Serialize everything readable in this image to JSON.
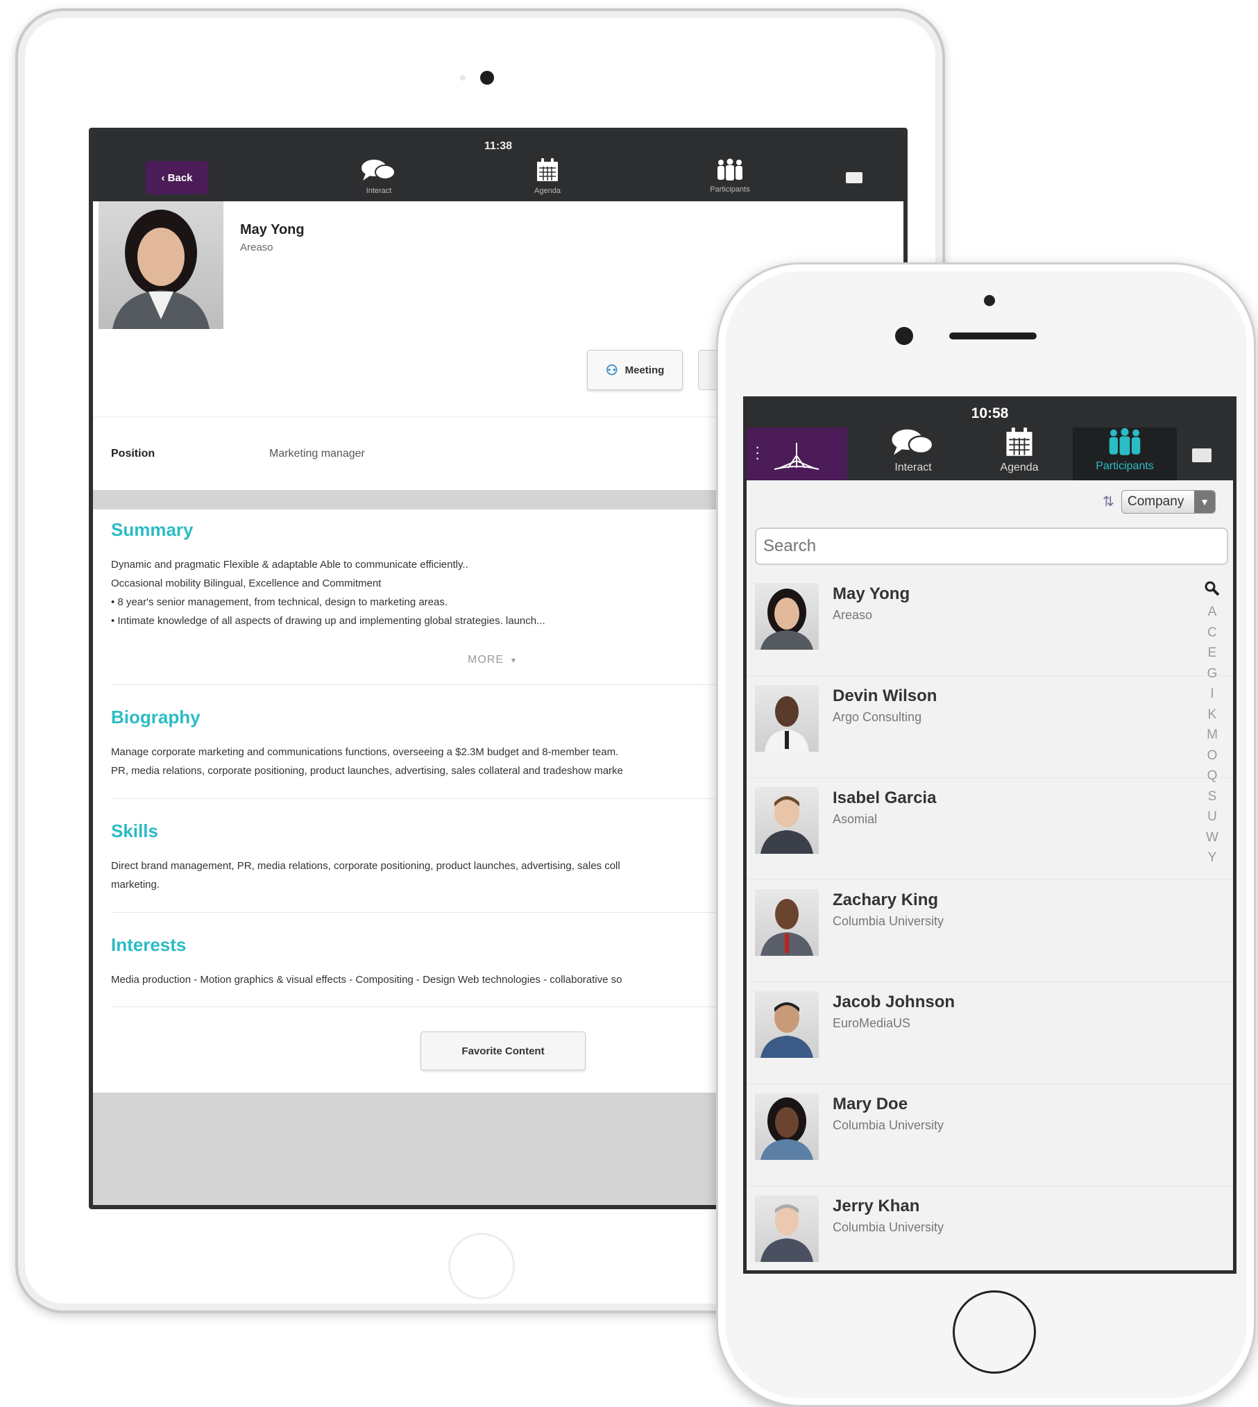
{
  "ipad": {
    "status_time": "11:38",
    "back_label": "Back",
    "tabs": [
      {
        "label": "Interact",
        "icon": "chat-icon"
      },
      {
        "label": "Agenda",
        "icon": "calendar-icon"
      },
      {
        "label": "Participants",
        "icon": "people-icon"
      }
    ],
    "profile": {
      "name": "May Yong",
      "company": "Areaso",
      "meeting_label": "Meeting",
      "position_label": "Position",
      "position_value": "Marketing manager"
    },
    "summary": {
      "title": "Summary",
      "lines": [
        "Dynamic and pragmatic Flexible & adaptable Able to communicate efficiently..",
        "Occasional mobility Bilingual, Excellence and Commitment",
        "• 8 year's senior management, from technical, design to marketing areas.",
        "• Intimate knowledge of all aspects of drawing up and implementing global strategies. launch..."
      ],
      "more_label": "MORE"
    },
    "biography": {
      "title": "Biography",
      "lines": [
        "Manage corporate marketing and communications functions, overseeing a $2.3M budget and 8-member team.",
        "PR, media relations, corporate positioning, product launches, advertising, sales collateral and tradeshow marke"
      ]
    },
    "skills": {
      "title": "Skills",
      "lines": [
        "Direct brand management, PR, media relations, corporate positioning, product launches, advertising, sales coll",
        "marketing."
      ]
    },
    "interests": {
      "title": "Interests",
      "lines": [
        "Media production - Motion graphics & visual effects - Compositing - Design Web technologies - collaborative so"
      ]
    },
    "favorite_content_label": "Favorite Content"
  },
  "iphone": {
    "status_time": "10:58",
    "tabs": [
      {
        "label": "Interact",
        "icon": "chat-icon"
      },
      {
        "label": "Agenda",
        "icon": "calendar-icon"
      },
      {
        "label": "Participants",
        "icon": "people-icon"
      }
    ],
    "active_tab": "Participants",
    "sort_select": "Company",
    "search_placeholder": "Search",
    "participants": [
      {
        "name": "May Yong",
        "company": "Areaso"
      },
      {
        "name": "Devin Wilson",
        "company": "Argo Consulting"
      },
      {
        "name": "Isabel Garcia",
        "company": "Asomial"
      },
      {
        "name": "Zachary King",
        "company": "Columbia University"
      },
      {
        "name": "Jacob Johnson",
        "company": "EuroMediaUS"
      },
      {
        "name": "Mary Doe",
        "company": "Columbia University"
      },
      {
        "name": "Jerry Khan",
        "company": "Columbia University"
      }
    ],
    "alphabet_index": [
      "A",
      "C",
      "E",
      "G",
      "I",
      "K",
      "M",
      "O",
      "Q",
      "S",
      "U",
      "W",
      "Y"
    ]
  },
  "colors": {
    "accent_teal": "#2bbcc6",
    "brand_purple": "#4b1c57",
    "nav_bar": "#2d2e30"
  }
}
